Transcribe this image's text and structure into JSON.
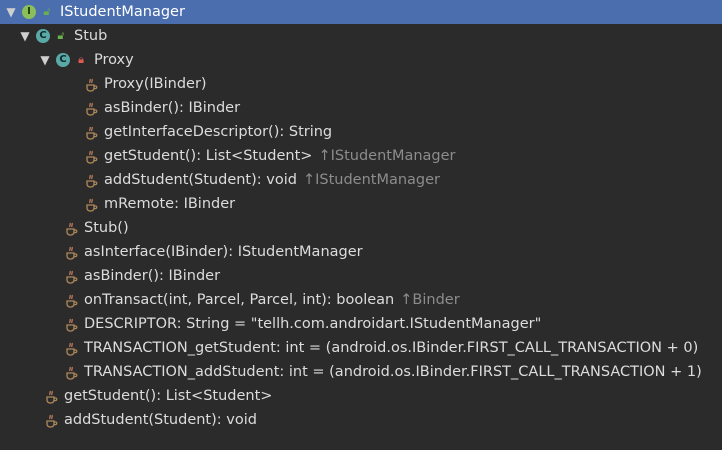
{
  "tree": {
    "root": {
      "label": "IStudentManager",
      "badge": "I"
    },
    "stub": {
      "label": "Stub",
      "badge": "C"
    },
    "proxy": {
      "label": "Proxy",
      "badge": "C"
    },
    "proxy_members": [
      {
        "label": "Proxy(IBinder)",
        "inherit": ""
      },
      {
        "label": "asBinder(): IBinder",
        "inherit": ""
      },
      {
        "label": "getInterfaceDescriptor(): String",
        "inherit": ""
      },
      {
        "label": "getStudent(): List<Student>",
        "inherit": "↑IStudentManager"
      },
      {
        "label": "addStudent(Student): void",
        "inherit": "↑IStudentManager"
      },
      {
        "label": "mRemote: IBinder",
        "inherit": ""
      }
    ],
    "stub_members": [
      {
        "label": "Stub()",
        "inherit": ""
      },
      {
        "label": "asInterface(IBinder): IStudentManager",
        "inherit": ""
      },
      {
        "label": "asBinder(): IBinder",
        "inherit": ""
      },
      {
        "label": "onTransact(int, Parcel, Parcel, int): boolean",
        "inherit": "↑Binder"
      },
      {
        "label": "DESCRIPTOR: String = \"tellh.com.androidart.IStudentManager\"",
        "inherit": ""
      },
      {
        "label": "TRANSACTION_getStudent: int = (android.os.IBinder.FIRST_CALL_TRANSACTION + 0)",
        "inherit": ""
      },
      {
        "label": "TRANSACTION_addStudent: int = (android.os.IBinder.FIRST_CALL_TRANSACTION + 1)",
        "inherit": ""
      }
    ],
    "root_members": [
      {
        "label": "getStudent(): List<Student>"
      },
      {
        "label": "addStudent(Student): void"
      }
    ]
  },
  "icons": {
    "expand": "chevron-down-icon",
    "interface": "interface-badge-icon",
    "class": "class-badge-icon",
    "unlocked": "unlock-icon",
    "locked": "lock-icon",
    "member": "java-coffee-icon"
  },
  "colors": {
    "background": "#2b2b2b",
    "selection": "#4b6eaf",
    "interface_badge": "#8bbf59",
    "class_badge": "#5aa9a6",
    "lock": "#e05a50",
    "unlock": "#6ab04c",
    "inherit_text": "#8c8c8c"
  }
}
